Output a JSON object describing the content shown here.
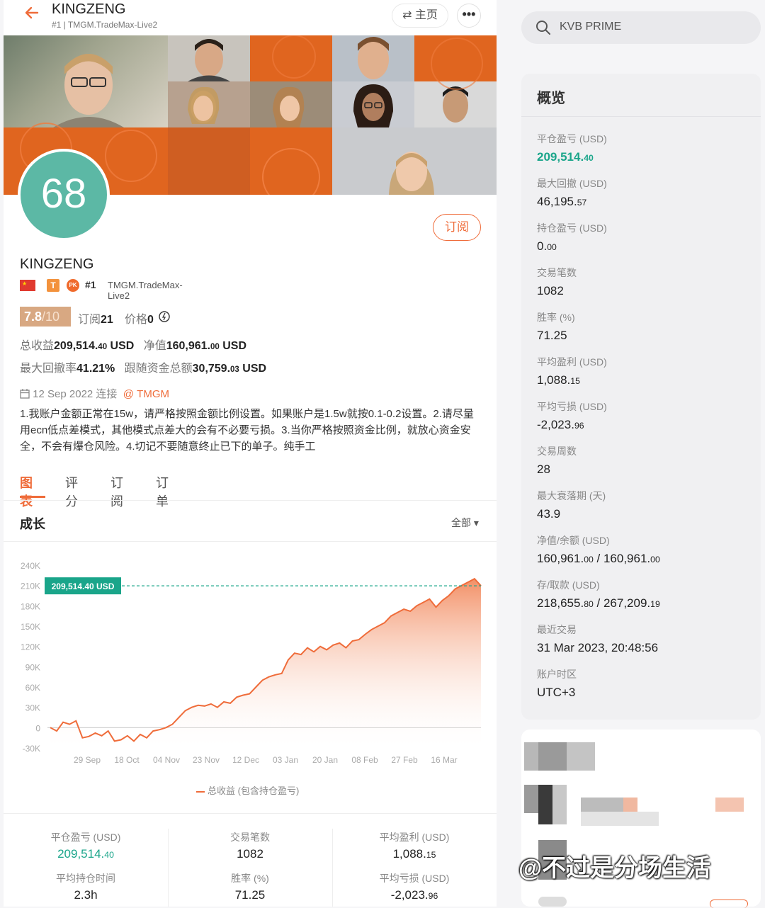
{
  "header": {
    "back_icon": "arrow-left-icon",
    "title": "KINGZENG",
    "subtitle": "#1 | TMGM.TradeMax-Live2",
    "home_label": "⇄ 主页",
    "more_label": "•••"
  },
  "profile": {
    "avatar_text": "68",
    "subscribe_label": "订阅",
    "name": "KINGZENG",
    "rank": "#1",
    "server": "TMGM.TradeMax-Live2",
    "badge_t": "T",
    "badge_pk": "PK",
    "score": "7.8",
    "score_of": "/10",
    "subs_label": "订阅",
    "subs_value": "21",
    "price_label": "价格",
    "price_value": "0",
    "total_profit_label": "总收益",
    "total_profit_int": "209,514.",
    "total_profit_dec": "40",
    "total_profit_unit": " USD",
    "equity_label": "净值",
    "equity_int": "160,961.",
    "equity_dec": "00",
    "equity_unit": " USD",
    "max_dd_label": "最大回撤率",
    "max_dd_value": "41.21%",
    "follow_funds_label": "跟随资金总额",
    "follow_funds_int": "30,759.",
    "follow_funds_dec": "03",
    "follow_funds_unit": " USD",
    "connected": "12 Sep 2022 连接",
    "broker_tag": "@ TMGM",
    "description": "1.我账户金额正常在15w，请严格按照金额比例设置。如果账户是1.5w就按0.1-0.2设置。2.请尽量用ecn低点差模式，其他模式点差大的会有不必要亏损。3.当你严格按照资金比例，就放心资金安全，不会有爆仓风险。4.切记不要随意终止已下的单子。纯手工"
  },
  "tabs": [
    "图表",
    "评分",
    "订阅",
    "订单"
  ],
  "chart_section": {
    "title": "成长",
    "range_label": "全部 ▾",
    "legend": "总收益 (包含持仓盈亏)",
    "current_label": "209,514.40 USD"
  },
  "chart_data": {
    "type": "area",
    "ylim": [
      -30000,
      240000
    ],
    "yticks": [
      "240K",
      "210K",
      "180K",
      "150K",
      "120K",
      "90K",
      "60K",
      "30K",
      "0",
      "-30K"
    ],
    "xticks": [
      "29 Sep",
      "18 Oct",
      "04 Nov",
      "23 Nov",
      "12 Dec",
      "03 Jan",
      "20 Jan",
      "08 Feb",
      "27 Feb",
      "16 Mar"
    ],
    "series": [
      {
        "name": "总收益 (包含持仓盈亏)",
        "values": [
          0,
          -5000,
          8000,
          5000,
          10000,
          -15000,
          -13000,
          -8000,
          -12000,
          -5000,
          -20000,
          -18000,
          -12000,
          -20000,
          -10000,
          -15000,
          -5000,
          -3000,
          0,
          5000,
          15000,
          25000,
          30000,
          33000,
          32000,
          35000,
          30000,
          38000,
          36000,
          45000,
          48000,
          50000,
          60000,
          70000,
          75000,
          78000,
          80000,
          100000,
          110000,
          108000,
          118000,
          112000,
          120000,
          115000,
          122000,
          125000,
          118000,
          128000,
          130000,
          138000,
          145000,
          150000,
          155000,
          165000,
          170000,
          175000,
          172000,
          180000,
          185000,
          190000,
          178000,
          188000,
          195000,
          205000,
          210000,
          215000,
          220000,
          209514
        ]
      }
    ],
    "colors": {
      "line": "#ef6c3a",
      "fill_top": "#f28a5e",
      "marker": "#1aa58a"
    }
  },
  "bottom_stats": [
    {
      "label": "平仓盈亏 (USD)",
      "int": "209,514.",
      "dec": "40",
      "green": true
    },
    {
      "label": "交易笔数",
      "int": "1082",
      "dec": "",
      "green": false
    },
    {
      "label": "平均盈利 (USD)",
      "int": "1,088.",
      "dec": "15",
      "green": false
    },
    {
      "label": "平均持仓时间",
      "int": "2.3h",
      "dec": "",
      "green": false
    },
    {
      "label": "胜率 (%)",
      "int": "71.25",
      "dec": "",
      "green": false
    },
    {
      "label": "平均亏损 (USD)",
      "int": "-2,023.",
      "dec": "96",
      "green": false
    }
  ],
  "search": {
    "placeholder": "KVB PRIME",
    "icon": "search-icon"
  },
  "overview": {
    "title": "概览",
    "items": [
      {
        "label": "平仓盈亏 (USD)",
        "int": "209,514.",
        "dec": "40",
        "green": true
      },
      {
        "label": "最大回撤 (USD)",
        "int": "46,195.",
        "dec": "57"
      },
      {
        "label": "持仓盈亏 (USD)",
        "int": "0.",
        "dec": "00"
      },
      {
        "label": "交易笔数",
        "int": "1082",
        "dec": ""
      },
      {
        "label": "胜率 (%)",
        "int": "71.25",
        "dec": ""
      },
      {
        "label": "平均盈利 (USD)",
        "int": "1,088.",
        "dec": "15"
      },
      {
        "label": "平均亏损 (USD)",
        "int": "-2,023.",
        "dec": "96"
      },
      {
        "label": "交易周数",
        "int": "28",
        "dec": ""
      },
      {
        "label": "最大衰落期 (天)",
        "int": "43.9",
        "dec": ""
      },
      {
        "label": "净值/余额 (USD)",
        "int": "160,961.",
        "dec": "00",
        "int2": " / 160,961.",
        "dec2": "00"
      },
      {
        "label": "存/取款 (USD)",
        "int": "218,655.",
        "dec": "80",
        "int2": " / 267,209.",
        "dec2": "19"
      },
      {
        "label": "最近交易",
        "int": "31 Mar 2023, 20:48:56",
        "dec": ""
      },
      {
        "label": "账户时区",
        "int": "UTC+3",
        "dec": ""
      }
    ]
  },
  "watermark": "@不过是分场生活"
}
